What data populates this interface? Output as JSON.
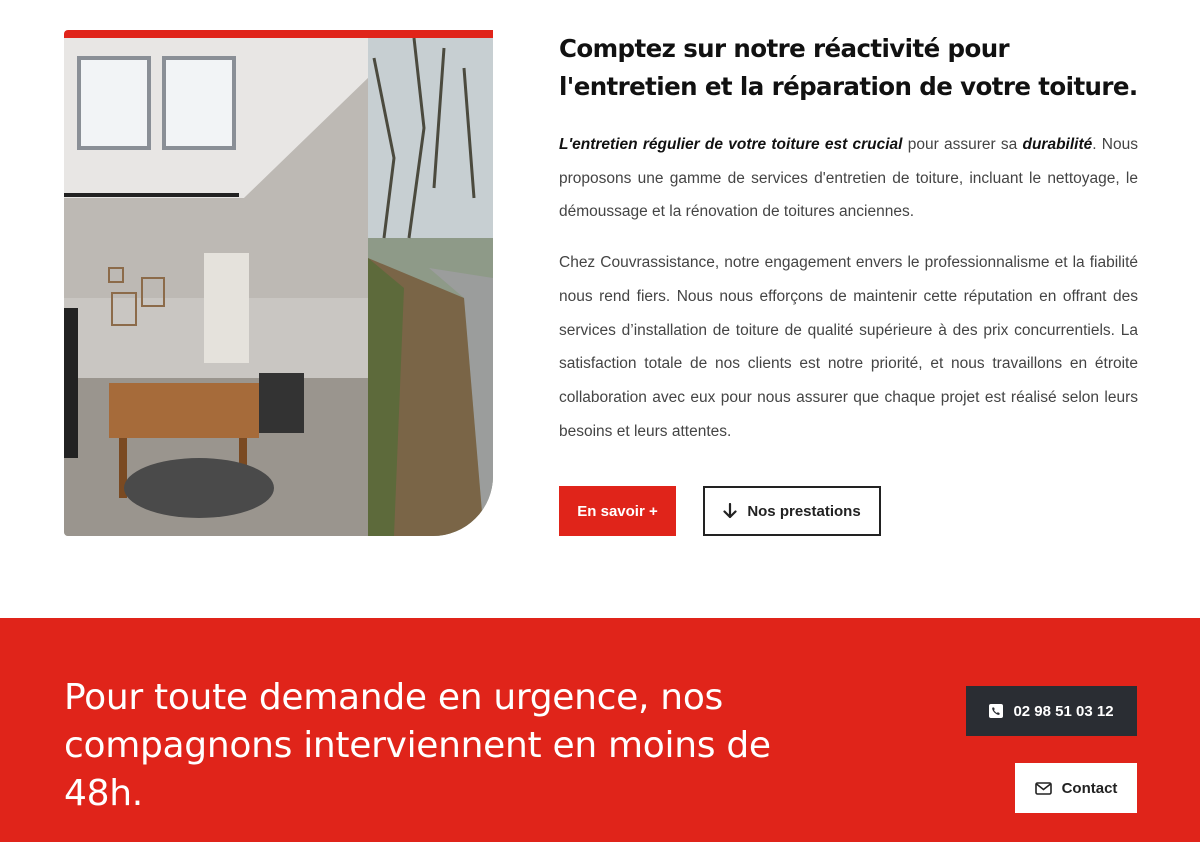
{
  "intro": {
    "heading": "Comptez sur notre réactivité pour l'entretien et la réparation de votre toiture.",
    "p1_em1": "L'entretien régulier de votre toiture est crucial",
    "p1_text1": " pour assurer sa ",
    "p1_em2": "durabilité",
    "p1_text2": ". Nous proposons une gamme de services d'entretien de toiture, incluant le nettoyage, le démoussage et la rénovation de toitures anciennes.",
    "p2": "Chez Couvrassistance, notre engagement envers le professionnalisme et la fiabilité nous rend fiers. Nous nous efforçons de maintenir cette réputation en offrant des services d’installation de toiture de qualité supérieure à des prix concurrentiels. La satisfaction totale de nos clients est notre priorité, et nous travaillons en étroite collaboration avec eux pour nous assurer que chaque projet est réalisé selon leurs besoins et leurs attentes."
  },
  "buttons": {
    "more_label": "En savoir +",
    "services_label": "Nos prestations",
    "services_icon": "arrow-down-icon"
  },
  "banner": {
    "text": "Pour toute demande en urgence, nos compagnons interviennent en moins de 48h.",
    "phone_label": "02 98 51 03 12",
    "phone_icon": "phone-icon",
    "contact_label": "Contact",
    "contact_icon": "envelope-icon"
  },
  "colors": {
    "accent": "#e0241a",
    "dark_button": "#2a2d33"
  }
}
